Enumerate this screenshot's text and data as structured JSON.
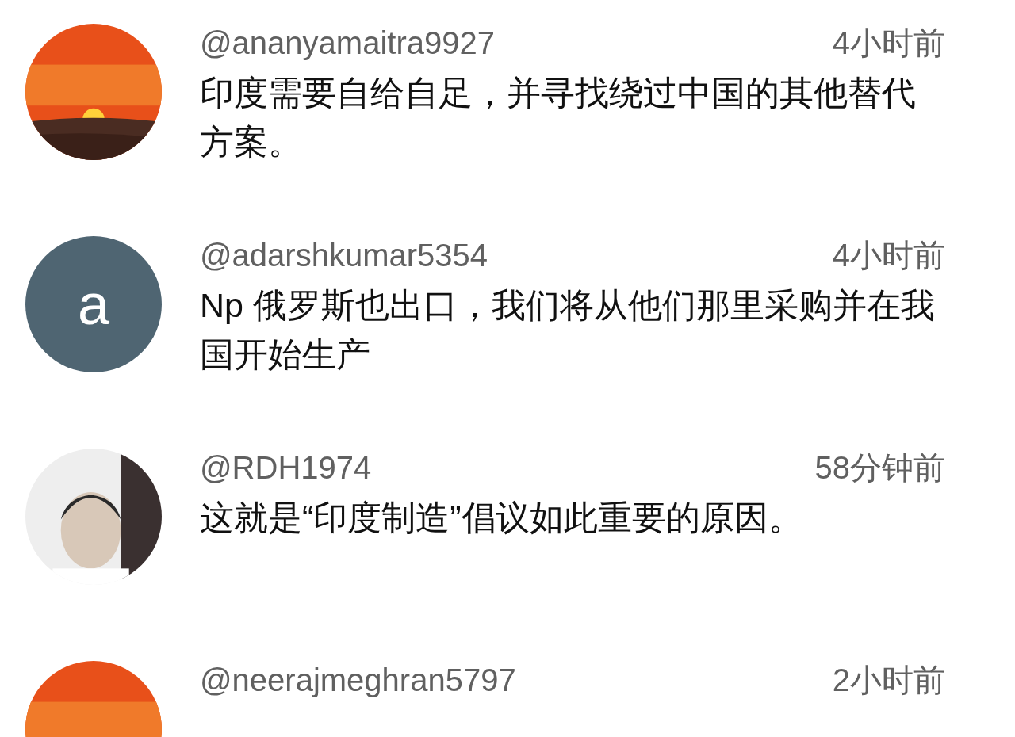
{
  "comments": [
    {
      "user": "@ananyamaitra9927",
      "time": "4小时前",
      "text": "印度需要自给自足，并寻找绕过中国的其他替代方案。"
    },
    {
      "avatar": {
        "kind": "letter",
        "letter": "a"
      },
      "user": "@adarshkumar5354",
      "time": "4小时前",
      "text": "Np 俄罗斯也出口，我们将从他们那里采购并在我国开始生产"
    },
    {
      "user": "@RDH1974",
      "time": "58分钟前",
      "text": "这就是“印度制造”倡议如此重要的原因。"
    },
    {
      "user": "@neerajmeghran5797",
      "time": "2小时前"
    }
  ]
}
